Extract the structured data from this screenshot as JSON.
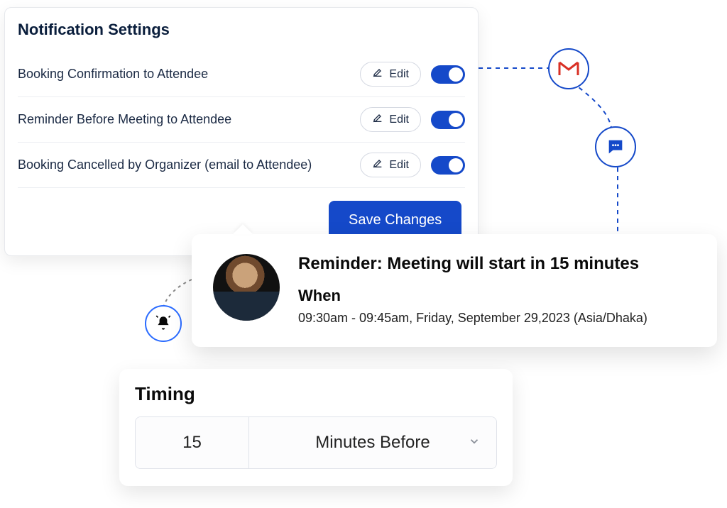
{
  "notifications": {
    "title": "Notification Settings",
    "edit_label": "Edit",
    "save_label": "Save Changes",
    "rows": [
      {
        "label": "Booking Confirmation to Attendee"
      },
      {
        "label": "Reminder Before Meeting to Attendee"
      },
      {
        "label": "Booking Cancelled by Organizer (email to Attendee)"
      }
    ]
  },
  "reminder": {
    "title": "Reminder: Meeting will start in 15 minutes",
    "when_label": "When",
    "when_value": "09:30am  - 09:45am, Friday, September 29,2023 (Asia/Dhaka)"
  },
  "timing": {
    "title": "Timing",
    "value": "15",
    "unit": "Minutes Before"
  },
  "icons": {
    "gmail": "gmail-icon",
    "chat": "chat-icon",
    "bell": "bell-icon"
  }
}
